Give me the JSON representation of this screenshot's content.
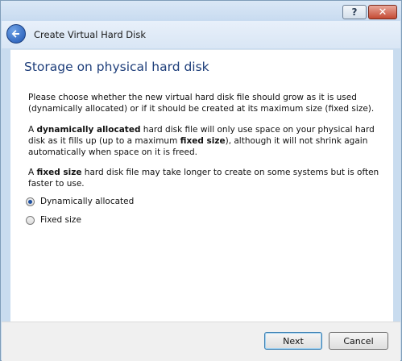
{
  "window": {
    "help_label": "?",
    "close_label": "✕"
  },
  "header": {
    "title": "Create Virtual Hard Disk",
    "back_icon": "back-arrow-icon"
  },
  "page": {
    "title": "Storage on physical hard disk",
    "p1": "Please choose whether the new virtual hard disk file should grow as it is used (dynamically allocated) or if it should be created at its maximum size (fixed size).",
    "p2": {
      "pre": "A ",
      "b1": "dynamically allocated",
      "mid": " hard disk file will only use space on your physical hard disk as it fills up (up to a maximum ",
      "b2": "fixed size",
      "post": "), although it will not shrink again automatically when space on it is freed."
    },
    "p3": {
      "pre": "A ",
      "b1": "fixed size",
      "post": " hard disk file may take longer to create on some systems but is often faster to use."
    }
  },
  "options": [
    {
      "label": "Dynamically allocated",
      "checked": true
    },
    {
      "label": "Fixed size",
      "checked": false
    }
  ],
  "footer": {
    "next_label": "Next",
    "cancel_label": "Cancel"
  }
}
